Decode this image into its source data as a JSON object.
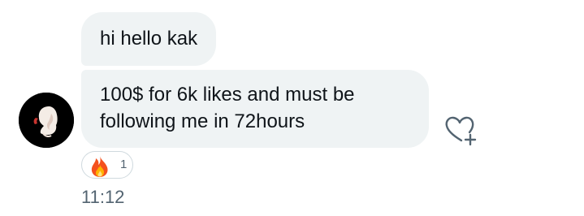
{
  "messages": [
    {
      "text": "hi hello kak"
    },
    {
      "text": "100$ for 6k likes and must be following me in 72hours"
    }
  ],
  "reactions": [
    {
      "emoji": "fire-icon",
      "count": "1"
    }
  ],
  "timestamp": "11:12",
  "icons": {
    "add_reaction": "heart-plus-icon",
    "avatar": "avatar"
  },
  "colors": {
    "bubble_bg": "#eff3f4",
    "text": "#0f1419",
    "muted": "#536471",
    "chip_border": "#cfd9de"
  }
}
